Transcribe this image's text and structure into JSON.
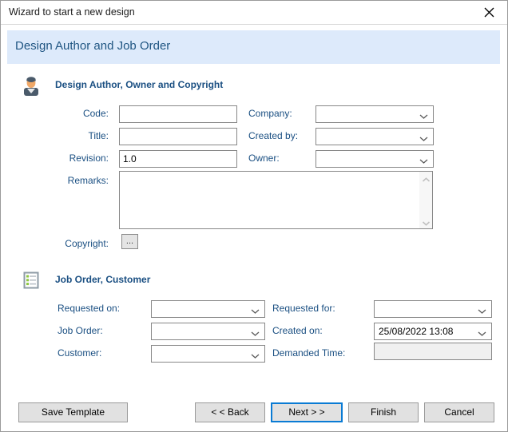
{
  "window": {
    "title": "Wizard to start a new design",
    "close_icon": "close-icon"
  },
  "banner": {
    "heading": "Design Author and Job Order"
  },
  "sections": [
    {
      "id": "author",
      "icon": "user-avatar-icon",
      "title": "Design Author, Owner and Copyright",
      "fields": {
        "code_label": "Code:",
        "code_value": "",
        "title_label": "Title:",
        "title_value": "",
        "revision_label": "Revision:",
        "revision_value": "1.0",
        "remarks_label": "Remarks:",
        "remarks_value": "",
        "copyright_label": "Copyright:",
        "copyright_button": "...",
        "company_label": "Company:",
        "company_value": "",
        "created_by_label": "Created by:",
        "created_by_value": "",
        "owner_label": "Owner:",
        "owner_value": ""
      }
    },
    {
      "id": "joborder",
      "icon": "clipboard-checklist-icon",
      "title": "Job Order, Customer",
      "fields": {
        "requested_on_label": "Requested on:",
        "requested_on_value": "",
        "job_order_label": "Job Order:",
        "job_order_value": "",
        "customer_label": "Customer:",
        "customer_value": "",
        "requested_for_label": "Requested for:",
        "requested_for_value": "",
        "created_on_label": "Created on:",
        "created_on_value": "25/08/2022 13:08",
        "demanded_time_label": "Demanded Time:",
        "demanded_time_value": ""
      }
    }
  ],
  "footer": {
    "save_template": "Save Template",
    "back": "< < Back",
    "next": "Next > >",
    "finish": "Finish",
    "cancel": "Cancel"
  },
  "colors": {
    "banner_bg": "#ddeafb",
    "label_blue": "#1a4f82",
    "focus_blue": "#0a7bd4",
    "button_face": "#e1e1e1",
    "disabled_field": "#f0f0f0"
  }
}
